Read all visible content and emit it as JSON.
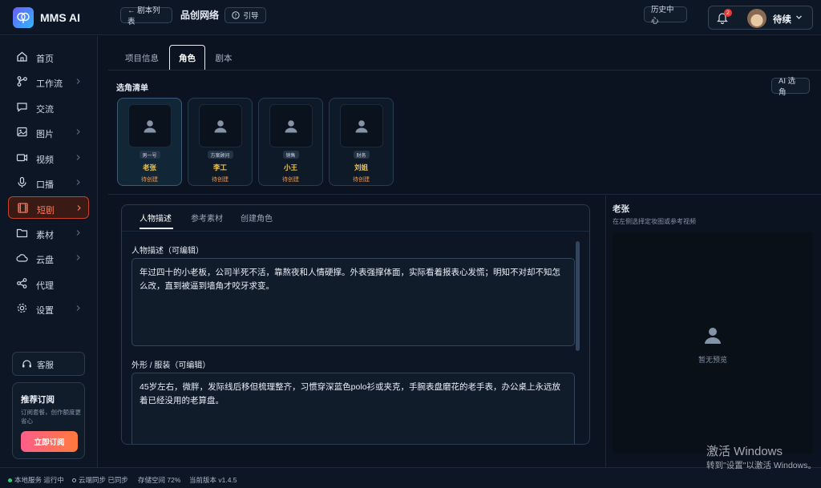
{
  "app": {
    "name": "MMS AI"
  },
  "header": {
    "back_label": "← 剧本列表",
    "title": "品创网络",
    "guide_label": "引导",
    "history_label": "历史中心",
    "notification_count": "2",
    "user_name": "待续"
  },
  "sidebar": {
    "items": [
      {
        "label": "首页",
        "icon": "home-icon",
        "arrow": false
      },
      {
        "label": "工作流",
        "icon": "workflow-icon",
        "arrow": true
      },
      {
        "label": "交流",
        "icon": "chat-icon",
        "arrow": false
      },
      {
        "label": "图片",
        "icon": "image-icon",
        "arrow": true
      },
      {
        "label": "视频",
        "icon": "video-icon",
        "arrow": true
      },
      {
        "label": "口播",
        "icon": "mic-icon",
        "arrow": true
      },
      {
        "label": "短剧",
        "icon": "film-icon",
        "arrow": true,
        "active": true
      },
      {
        "label": "素材",
        "icon": "folder-icon",
        "arrow": true
      },
      {
        "label": "云盘",
        "icon": "cloud-icon",
        "arrow": true
      },
      {
        "label": "代理",
        "icon": "share-icon",
        "arrow": false
      },
      {
        "label": "设置",
        "icon": "gear-icon",
        "arrow": true
      }
    ],
    "service_label": "客服",
    "subscription": {
      "title": "推荐订阅",
      "desc": "订阅套餐，创作额度更省心",
      "button": "立即订阅"
    }
  },
  "tabs": [
    {
      "label": "项目信息"
    },
    {
      "label": "角色",
      "active": true
    },
    {
      "label": "剧本"
    }
  ],
  "roles_section": {
    "title": "选角清单",
    "ai_button": "AI 选角",
    "roles": [
      {
        "tag": "男一号",
        "name": "老张",
        "status": "待创建",
        "active": true
      },
      {
        "tag": "方案顾问",
        "name": "李工",
        "status": "待创建"
      },
      {
        "tag": "销售",
        "name": "小王",
        "status": "待创建"
      },
      {
        "tag": "财务",
        "name": "刘姐",
        "status": "待创建"
      }
    ]
  },
  "detail": {
    "tabs": [
      {
        "label": "人物描述",
        "active": true
      },
      {
        "label": "参考素材"
      },
      {
        "label": "创建角色"
      }
    ],
    "description_label": "人物描述（可编辑）",
    "description": "年过四十的小老板，公司半死不活，靠熬夜和人情硬撑。外表强撑体面，实际看着报表心发慌；明知不对却不知怎么改，直到被逼到墙角才咬牙求变。",
    "appearance_label": "外形 / 服装（可编辑）",
    "appearance": "45岁左右，微胖，发际线后移但梳理整齐，习惯穿深蓝色polo衫或夹克，手腕表盘磨花的老手表，办公桌上永远放着已经没用的老算盘。"
  },
  "preview": {
    "name": "老张",
    "hint": "在左侧选择定妆图或参考视频",
    "empty": "暂无预览"
  },
  "statusbar": {
    "local": "本地服务 运行中",
    "cloud": "云端同步 已同步",
    "storage": "存储空间 72%",
    "version": "当前版本 v1.4.5"
  },
  "watermark": {
    "line1": "激活 Windows",
    "line2": "转到\"设置\"以激活 Windows。"
  },
  "colors": {
    "accent": "#ff7a5a",
    "role_name": "#f2c94c",
    "status": "#f2994a",
    "running": "#2ecc71"
  }
}
